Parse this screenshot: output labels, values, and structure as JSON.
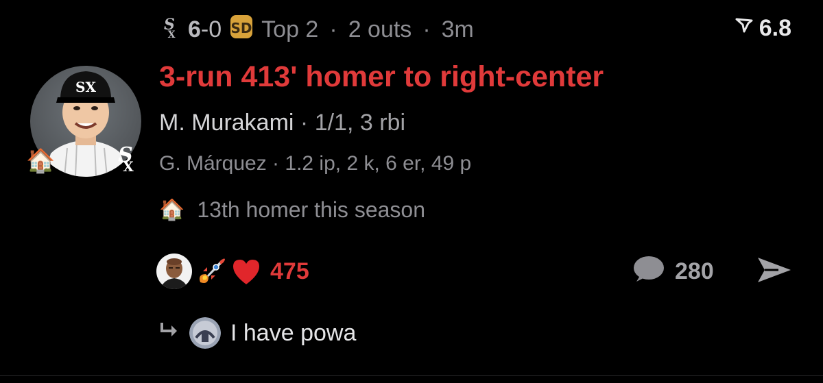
{
  "header": {
    "home_team_icon": "white-sox-logo-icon",
    "away_team_icon": "padres-logo-icon",
    "score_home": "6",
    "score_dash": "-",
    "score_away": "0",
    "inning": "Top 2",
    "outs": "2 outs",
    "time_ago": "3m",
    "separator": "·",
    "speed_icon": "exit-velocity-icon",
    "speed_value": "6.8"
  },
  "play": {
    "headline": "3-run 413' homer to right-center",
    "batter_name": "M. Murakami",
    "batter_stats": "1/1, 3 rbi",
    "pitcher_line": "G. Márquez · 1.2 ip, 2 k, 6 er, 49 p",
    "note_icon": "house-emoji",
    "note_text": "13th homer this season"
  },
  "reactions": {
    "icons": [
      "person-face-icon",
      "rocket-emoji",
      "heart-emoji"
    ],
    "likes": "475",
    "comment_icon": "speech-bubble-icon",
    "comments": "280",
    "share_icon": "send-arrow-icon"
  },
  "reply": {
    "icon": "reply-arrow-icon",
    "avatar_icon": "user-avatar-icon",
    "text": "I have powa"
  },
  "colors": {
    "background": "#000000",
    "accent_red": "#e03a3a",
    "muted_text": "#8e8e93"
  }
}
